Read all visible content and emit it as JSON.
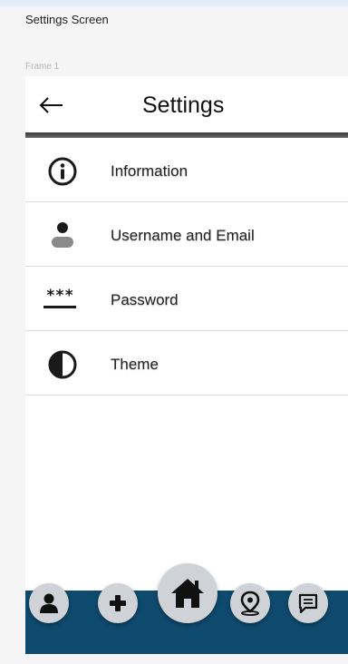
{
  "screen_title": "Settings Screen",
  "frame_label": "Frame 1",
  "header": {
    "title": "Settings",
    "back_icon": "arrow-left-icon"
  },
  "settings_items": [
    {
      "label": "Information",
      "icon": "info-circle-icon"
    },
    {
      "label": "Username and Email",
      "icon": "user-icon"
    },
    {
      "label": "Password",
      "icon": "password-icon",
      "glyph": "***"
    },
    {
      "label": "Theme",
      "icon": "contrast-icon"
    }
  ],
  "bottom_nav": {
    "items": [
      {
        "name": "profile",
        "icon": "user-icon"
      },
      {
        "name": "add",
        "icon": "plus-icon"
      },
      {
        "name": "home",
        "icon": "home-icon"
      },
      {
        "name": "location",
        "icon": "map-pin-icon"
      },
      {
        "name": "messages",
        "icon": "message-icon"
      }
    ]
  },
  "colors": {
    "nav_background": "#0e4a6e",
    "nav_button": "#cfd3d8",
    "icon": "#1a1a1a",
    "header_rule": "#3a3a3a"
  }
}
